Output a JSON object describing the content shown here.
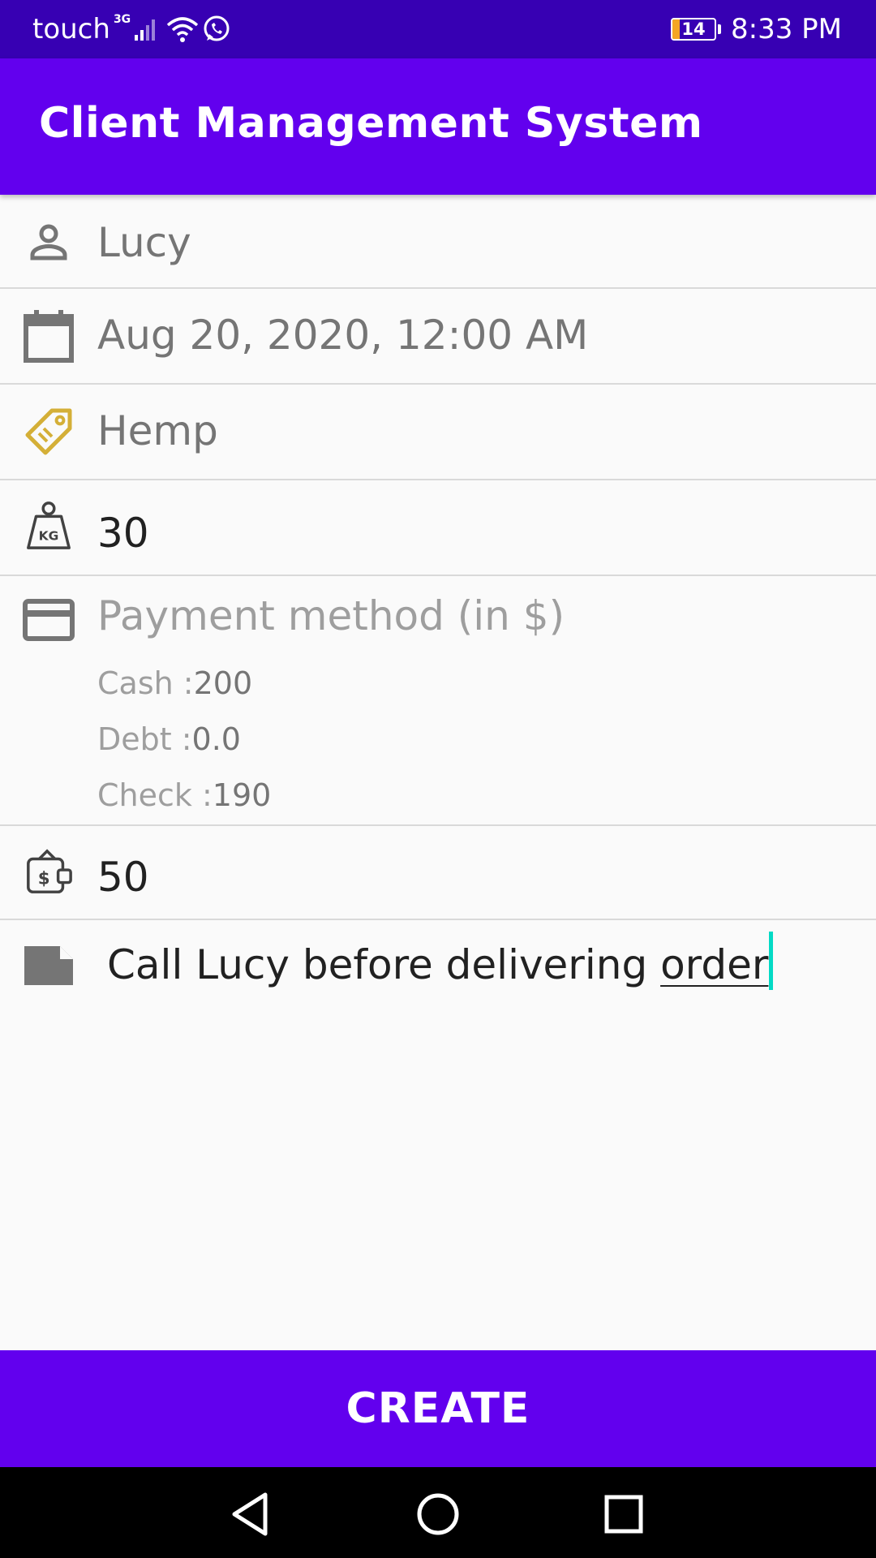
{
  "status_bar": {
    "carrier": "touch",
    "network_type": "3G",
    "battery_level": "14",
    "time": "8:33 PM",
    "icons": [
      "signal-icon",
      "wifi-icon",
      "whatsapp-icon",
      "battery-icon"
    ]
  },
  "app_bar": {
    "title": "Client Management System"
  },
  "form": {
    "client_name": {
      "value": "Lucy",
      "icon": "person-icon"
    },
    "date": {
      "value": "Aug 20, 2020, 12:00 AM",
      "icon": "calendar-icon"
    },
    "product": {
      "value": "Hemp",
      "icon": "tag-icon"
    },
    "weight": {
      "value": "30",
      "icon": "kg-weight-icon"
    },
    "payment": {
      "label": "Payment method (in $)",
      "icon": "credit-card-icon",
      "lines": [
        {
          "label": "Cash :",
          "value": "200"
        },
        {
          "label": "Debt :",
          "value": "0.0"
        },
        {
          "label": "Check :",
          "value": "190"
        }
      ]
    },
    "extra_amount": {
      "value": "50",
      "icon": "wallet-icon"
    },
    "note": {
      "text_before": "Call Lucy before delivering ",
      "text_underlined": "order",
      "icon": "note-icon"
    }
  },
  "actions": {
    "create_label": "CREATE"
  },
  "nav_bar": {
    "buttons": [
      "back-icon",
      "home-icon",
      "recents-icon"
    ]
  },
  "colors": {
    "primary": "#6200ee",
    "primary_dark": "#3700b3",
    "accent": "#03dac5",
    "tag_icon": "#d4af37"
  }
}
